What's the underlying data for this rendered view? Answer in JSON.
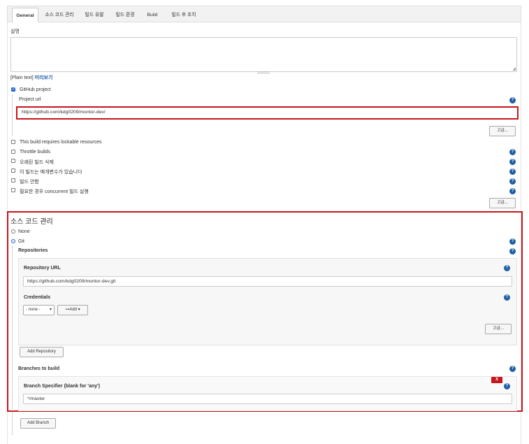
{
  "tabs": [
    {
      "label": "General",
      "active": true
    },
    {
      "label": "소스 코드 관리"
    },
    {
      "label": "빌드 유발"
    },
    {
      "label": "빌드 환경"
    },
    {
      "label": "Build"
    },
    {
      "label": "빌드 후 조치"
    }
  ],
  "general": {
    "description_label": "설명",
    "description_value": "",
    "plain_text": "[Plain text]",
    "preview_link": "미리보기",
    "github_project_label": "GitHub project",
    "github_project_checked": true,
    "project_url_label": "Project url",
    "project_url_value": "https://github.com/kdg0209/montor-dev/",
    "advanced_button": "고급...",
    "options": [
      {
        "label": "This build requires lockable resources",
        "checked": false,
        "help": false
      },
      {
        "label": "Throttle builds",
        "checked": false,
        "help": true
      },
      {
        "label": "오래된 빌드 삭제",
        "checked": false,
        "help": true
      },
      {
        "label": "이 빌드는 매개변수가 있습니다",
        "checked": false,
        "help": true
      },
      {
        "label": "빌드 안함",
        "checked": false,
        "help": true
      },
      {
        "label": "필요한 경우 concurrent 빌드 실행",
        "checked": false,
        "help": true
      }
    ],
    "advanced_button_2": "고급..."
  },
  "scm": {
    "title": "소스 코드 관리",
    "none_label": "None",
    "git_label": "Git",
    "selected": "Git",
    "repositories_label": "Repositories",
    "repository_url_label": "Repository URL",
    "repository_url_value": "https://github.com/kdg0209/montor-dev.git",
    "credentials_label": "Credentials",
    "credentials_selected": "- none -",
    "add_button": "Add",
    "advanced_button": "고급...",
    "add_repository_button": "Add Repository",
    "branches_label": "Branches to build",
    "delete_button": "X",
    "branch_specifier_label": "Branch Specifier (blank for 'any')",
    "branch_specifier_value": "*/master",
    "add_branch_button": "Add Branch"
  },
  "icons": {
    "help": "?",
    "chevron": "▾",
    "key": "⊶"
  },
  "colors": {
    "highlight_border": "#c8151b",
    "help_icon": "#1f5fa5",
    "delete_button": "#c8151b"
  }
}
